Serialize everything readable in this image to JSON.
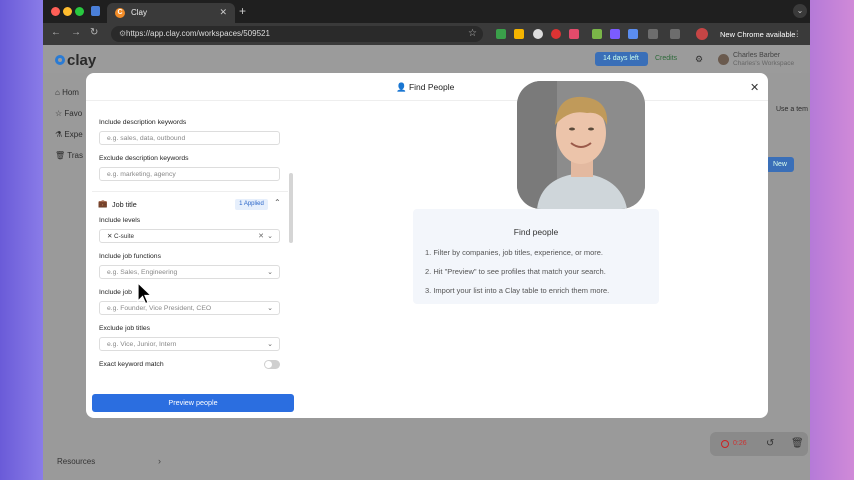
{
  "browser": {
    "tab_title": "Clay",
    "tab_favicon": "C",
    "url": "https://app.clay.com/workspaces/509521",
    "update_label": "New Chrome available"
  },
  "app": {
    "logo_text": "clay",
    "trial_label": "14 days left",
    "credits_label": "Credits",
    "user_name": "Charles Barber",
    "user_workspace": "Charles's Workspace",
    "sidebar": [
      {
        "label": "Hom"
      },
      {
        "label": "Favo"
      },
      {
        "label": "Expe"
      },
      {
        "label": "Tras"
      }
    ],
    "use_template_label": "Use a tem",
    "new_label": "New",
    "resources_label": "Resources"
  },
  "modal": {
    "title": "Find People",
    "filters": {
      "include_desc_label": "Include description keywords",
      "include_desc_placeholder": "e.g. sales, data, outbound",
      "exclude_desc_label": "Exclude description keywords",
      "exclude_desc_placeholder": "e.g. marketing, agency",
      "job_title_section": "Job title",
      "applied_badge": "1 Applied",
      "include_levels_label": "Include levels",
      "levels_tag": "C-suite",
      "include_functions_label": "Include job functions",
      "include_functions_placeholder": "e.g. Sales, Engineering",
      "include_titles_label": "Include job",
      "include_titles_placeholder": "e.g. Founder, Vice President, CEO",
      "exclude_titles_label": "Exclude job titles",
      "exclude_titles_placeholder": "e.g. Vice, Junior, Intern",
      "exact_match_label": "Exact keyword match",
      "exact_match_on": false
    },
    "preview_button": "Preview people",
    "info": {
      "title": "Find people",
      "steps": [
        "1. Filter by companies, job titles, experience, or more.",
        "2. Hit \"Preview\" to see profiles that match your search.",
        "3. Import your list into a Clay table to enrich them more."
      ]
    }
  },
  "recorder": {
    "time": "0:26"
  },
  "colors": {
    "accent": "#2b6ee0",
    "applied_bg": "#e6effc"
  }
}
